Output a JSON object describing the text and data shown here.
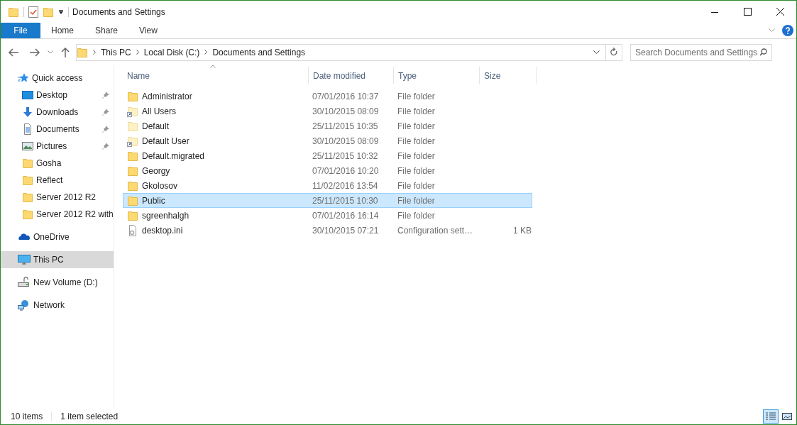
{
  "window": {
    "title": "Documents and Settings"
  },
  "ribbon_tabs": [
    {
      "label": "File",
      "kind": "file",
      "selected": false
    },
    {
      "label": "Home",
      "kind": "tab",
      "selected": false
    },
    {
      "label": "Share",
      "kind": "tab",
      "selected": false
    },
    {
      "label": "View",
      "kind": "tab",
      "selected": false
    }
  ],
  "breadcrumb": [
    "This PC",
    "Local Disk (C:)",
    "Documents and Settings"
  ],
  "search": {
    "placeholder": "Search Documents and Settings"
  },
  "sidebar": {
    "groups": [
      {
        "items": [
          {
            "label": "Quick access",
            "kind": "quick",
            "pinned": false,
            "selected": false
          },
          {
            "label": "Desktop",
            "kind": "desktop",
            "pinned": true,
            "selected": false
          },
          {
            "label": "Downloads",
            "kind": "downloads",
            "pinned": true,
            "selected": false
          },
          {
            "label": "Documents",
            "kind": "documents",
            "pinned": true,
            "selected": false
          },
          {
            "label": "Pictures",
            "kind": "pictures",
            "pinned": true,
            "selected": false
          },
          {
            "label": "Gosha",
            "kind": "folder",
            "pinned": false,
            "selected": false
          },
          {
            "label": "Reflect",
            "kind": "folder",
            "pinned": false,
            "selected": false
          },
          {
            "label": "Server 2012 R2",
            "kind": "folder",
            "pinned": false,
            "selected": false
          },
          {
            "label": "Server 2012 R2 with",
            "kind": "folder",
            "pinned": false,
            "selected": false
          }
        ]
      },
      {
        "items": [
          {
            "label": "OneDrive",
            "kind": "cloud",
            "pinned": false,
            "selected": false
          }
        ]
      },
      {
        "items": [
          {
            "label": "This PC",
            "kind": "pc",
            "pinned": false,
            "selected": true
          }
        ]
      },
      {
        "items": [
          {
            "label": "New Volume (D:)",
            "kind": "drive",
            "pinned": false,
            "selected": false
          }
        ]
      },
      {
        "items": [
          {
            "label": "Network",
            "kind": "network",
            "pinned": false,
            "selected": false
          }
        ]
      }
    ]
  },
  "table": {
    "columns": [
      "Name",
      "Date modified",
      "Type",
      "Size"
    ],
    "rows": [
      {
        "name": "Administrator",
        "date": "07/01/2016 10:37",
        "type": "File folder",
        "kind": "folder",
        "selected": false
      },
      {
        "name": "All Users",
        "date": "30/10/2015 08:09",
        "type": "File folder",
        "kind": "shortcut",
        "selected": false
      },
      {
        "name": "Default",
        "date": "25/11/2015 10:35",
        "type": "File folder",
        "kind": "hidden",
        "selected": false
      },
      {
        "name": "Default User",
        "date": "30/10/2015 08:09",
        "type": "File folder",
        "kind": "shortcut",
        "selected": false
      },
      {
        "name": "Default.migrated",
        "date": "25/11/2015 10:32",
        "type": "File folder",
        "kind": "folder",
        "selected": false
      },
      {
        "name": "Georgy",
        "date": "07/01/2016 10:20",
        "type": "File folder",
        "kind": "folder",
        "selected": false
      },
      {
        "name": "Gkolosov",
        "date": "11/02/2016 13:54",
        "type": "File folder",
        "kind": "folder",
        "selected": false
      },
      {
        "name": "Public",
        "date": "25/11/2015 10:30",
        "type": "File folder",
        "kind": "folder",
        "selected": true
      },
      {
        "name": "sgreenhalgh",
        "date": "07/01/2016 16:14",
        "type": "File folder",
        "kind": "folder",
        "selected": false
      },
      {
        "name": "desktop.ini",
        "date": "30/10/2015 07:21",
        "type": "Configuration sett…",
        "size": "1 KB",
        "kind": "file",
        "selected": false
      }
    ]
  },
  "status_bar": {
    "count": "10 items",
    "selection": "1 item selected"
  },
  "view_buttons": [
    {
      "kind": "details",
      "selected": true
    },
    {
      "kind": "large",
      "selected": false
    }
  ]
}
